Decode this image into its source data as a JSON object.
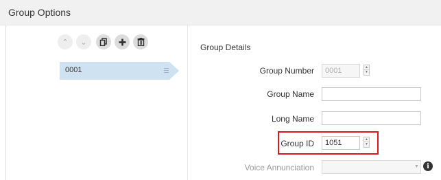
{
  "header": {
    "title": "Group Options"
  },
  "toolbar": {
    "move_up_icon": "chevron-up-icon",
    "move_down_icon": "chevron-down-icon",
    "copy_icon": "copy-icon",
    "add_icon": "plus-icon",
    "delete_icon": "trash-icon"
  },
  "group_list": {
    "items": [
      {
        "label": "0001",
        "selected": true
      }
    ]
  },
  "details": {
    "title": "Group Details",
    "group_number": {
      "label": "Group Number",
      "value": "0001",
      "disabled": true
    },
    "group_name": {
      "label": "Group Name",
      "value": ""
    },
    "long_name": {
      "label": "Long Name",
      "value": ""
    },
    "group_id": {
      "label": "Group ID",
      "value": "1051",
      "highlighted": true
    },
    "voice_annunciation": {
      "label": "Voice Annunciation",
      "value": "",
      "disabled": true
    }
  },
  "colors": {
    "highlight": "#e0141e",
    "selected_item": "#cfe2f1",
    "header_bg": "#f1f1f1"
  }
}
